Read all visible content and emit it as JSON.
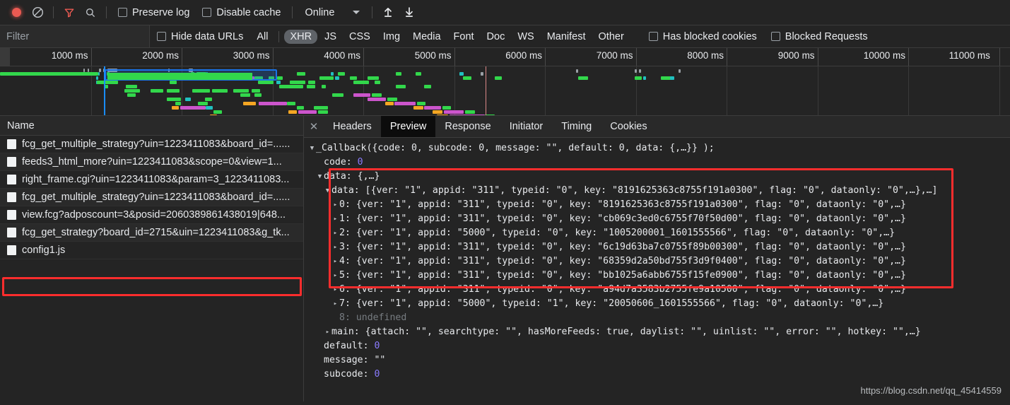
{
  "toolbar": {
    "record_icon": "record-dot-icon",
    "clear_icon": "clear-no-entry-icon",
    "filter_icon": "funnel-filter-icon",
    "search_icon": "search-magnifier-icon",
    "preserve_log_label": "Preserve log",
    "disable_cache_label": "Disable cache",
    "throttling_value": "Online",
    "import_icon": "import-arrow-up-icon",
    "export_icon": "export-arrow-down-icon"
  },
  "filterbar": {
    "filter_placeholder": "Filter",
    "filter_value": "",
    "hide_data_urls_label": "Hide data URLs",
    "types": [
      "All",
      "XHR",
      "JS",
      "CSS",
      "Img",
      "Media",
      "Font",
      "Doc",
      "WS",
      "Manifest",
      "Other"
    ],
    "selected_type": "XHR",
    "has_blocked_cookies_label": "Has blocked cookies",
    "blocked_requests_label": "Blocked Requests"
  },
  "overview": {
    "ticks": [
      "1000 ms",
      "2000 ms",
      "3000 ms",
      "4000 ms",
      "5000 ms",
      "6000 ms",
      "7000 ms",
      "8000 ms",
      "9000 ms",
      "10000 ms",
      "11000 ms"
    ]
  },
  "requests": {
    "column_header": "Name",
    "selected_index": 1,
    "items": [
      {
        "name": "fcg_get_multiple_strategy?uin=1223411083&board_id=......"
      },
      {
        "name": "feeds3_html_more?uin=1223411083&scope=0&view=1..."
      },
      {
        "name": "right_frame.cgi?uin=1223411083&param=3_1223411083..."
      },
      {
        "name": "fcg_get_multiple_strategy?uin=1223411083&board_id=......"
      },
      {
        "name": "view.fcg?adposcount=3&posid=2060389861438019|648..."
      },
      {
        "name": "fcg_get_strategy?board_id=2715&uin=1223411083&g_tk..."
      },
      {
        "name": "config1.js"
      }
    ]
  },
  "details": {
    "close_icon": "close-x-icon",
    "tabs": [
      "Headers",
      "Preview",
      "Response",
      "Initiator",
      "Timing",
      "Cookies"
    ],
    "active_tab": "Preview"
  },
  "preview": {
    "root_label": "_Callback({code: 0, subcode: 0, message: \"\", default: 0, data: {,…}} );",
    "code_key": "code:",
    "code_value": "0",
    "data_key": "data:",
    "data_value": "{,…}",
    "inner_data_key": "data:",
    "inner_data_value": "[{ver: \"1\", appid: \"311\", typeid: \"0\", key: \"8191625363c8755f191a0300\", flag: \"0\", dataonly: \"0\",…},…]",
    "array_items": [
      {
        "index": "0:",
        "text": "{ver: \"1\", appid: \"311\", typeid: \"0\", key: \"8191625363c8755f191a0300\", flag: \"0\", dataonly: \"0\",…}"
      },
      {
        "index": "1:",
        "text": "{ver: \"1\", appid: \"311\", typeid: \"0\", key: \"cb069c3ed0c6755f70f50d00\", flag: \"0\", dataonly: \"0\",…}"
      },
      {
        "index": "2:",
        "text": "{ver: \"1\", appid: \"5000\", typeid: \"0\", key: \"1005200001_1601555566\", flag: \"0\", dataonly: \"0\",…}"
      },
      {
        "index": "3:",
        "text": "{ver: \"1\", appid: \"311\", typeid: \"0\", key: \"6c19d63ba7c0755f89b00300\", flag: \"0\", dataonly: \"0\",…}"
      },
      {
        "index": "4:",
        "text": "{ver: \"1\", appid: \"311\", typeid: \"0\", key: \"68359d2a50bd755f3d9f0400\", flag: \"0\", dataonly: \"0\",…}"
      },
      {
        "index": "5:",
        "text": "{ver: \"1\", appid: \"311\", typeid: \"0\", key: \"bb1025a6abb6755f15fe0900\", flag: \"0\", dataonly: \"0\",…}"
      },
      {
        "index": "6:",
        "text": "{ver: \"1\", appid: \"311\", typeid: \"0\", key: \"a94d7a3583b2755fe9a10500\", flag: \"0\", dataonly: \"0\",…}"
      },
      {
        "index": "7:",
        "text": "{ver: \"1\", appid: \"5000\", typeid: \"1\", key: \"20050606_1601555566\", flag: \"0\", dataonly: \"0\",…}"
      }
    ],
    "undefined_row_index": "8:",
    "undefined_row_value": "undefined",
    "main_key": "main:",
    "main_value": "{attach: \"\", searchtype: \"\", hasMoreFeeds: true, daylist: \"\", uinlist: \"\", error: \"\", hotkey: \"\",…}",
    "default_key": "default:",
    "default_value": "0",
    "message_key": "message:",
    "message_value": "\"\"",
    "subcode_key": "subcode:",
    "subcode_value": "0"
  },
  "watermark": "https://blog.csdn.net/qq_45414559",
  "colors": {
    "accent_blue": "#1a73e8",
    "highlight_red": "#fc2d2d",
    "bar_green": "#32d74b",
    "bar_magenta": "#cc55cc",
    "bar_orange": "#f5a623",
    "bar_teal": "#20c0c0"
  }
}
